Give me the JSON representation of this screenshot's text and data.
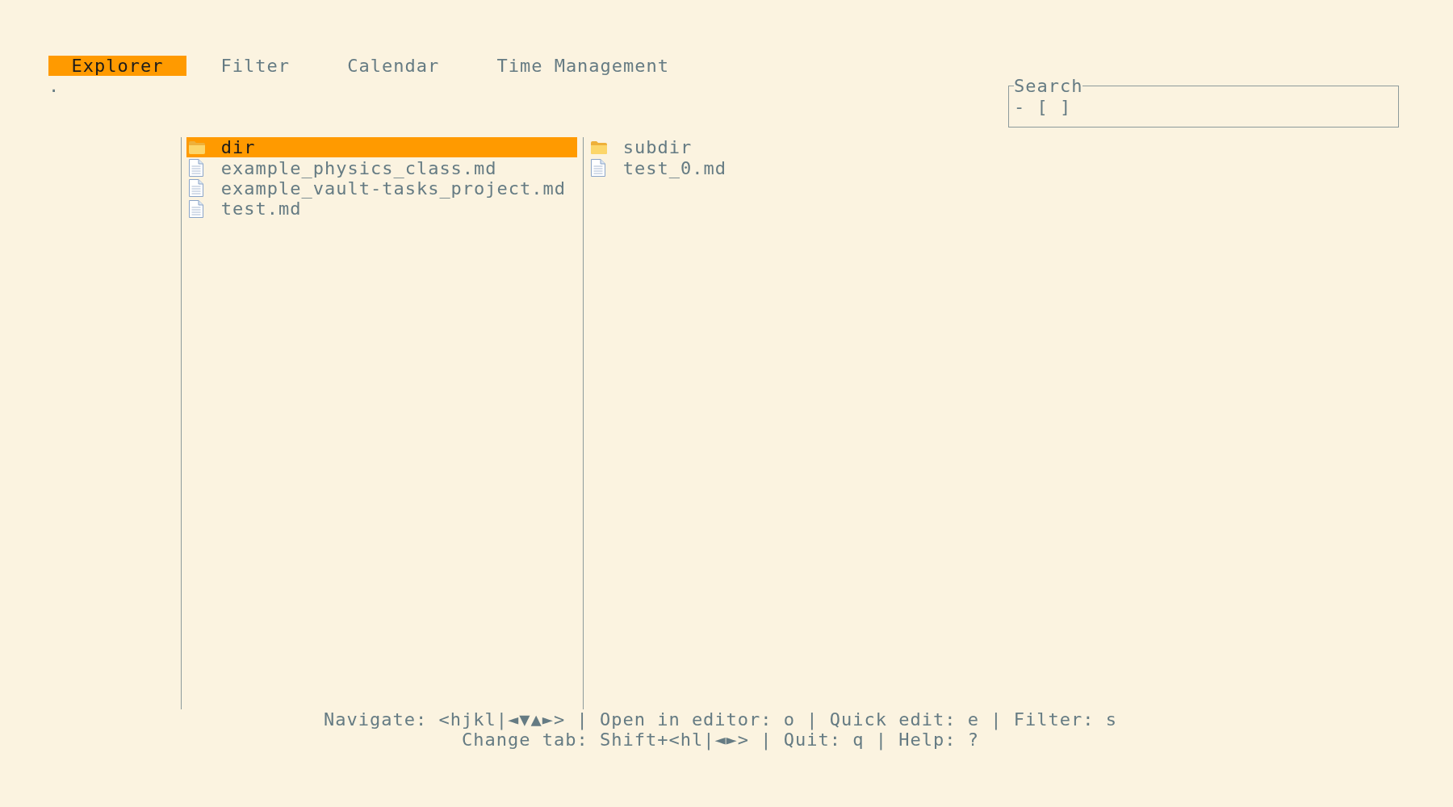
{
  "tabs": [
    {
      "label": "Explorer",
      "selected": true
    },
    {
      "label": "Filter",
      "selected": false
    },
    {
      "label": "Calendar",
      "selected": false
    },
    {
      "label": "Time Management",
      "selected": false
    }
  ],
  "path": ".",
  "search": {
    "title": "Search",
    "value": "- [ ]"
  },
  "explorer": {
    "current": [
      {
        "kind": "folder",
        "name": "dir",
        "selected": true
      },
      {
        "kind": "file",
        "name": "example_physics_class.md",
        "selected": false
      },
      {
        "kind": "file",
        "name": "example_vault-tasks_project.md",
        "selected": false
      },
      {
        "kind": "file",
        "name": "test.md",
        "selected": false
      }
    ],
    "preview": [
      {
        "kind": "folder",
        "name": "subdir",
        "selected": false
      },
      {
        "kind": "file",
        "name": "test_0.md",
        "selected": false
      }
    ]
  },
  "help": [
    "Navigate: <hjkl|◄▼▲►> | Open in editor: o | Quick edit: e | Filter: s",
    "Change tab: Shift+<hl|◄►> | Quit: q | Help: ?"
  ]
}
